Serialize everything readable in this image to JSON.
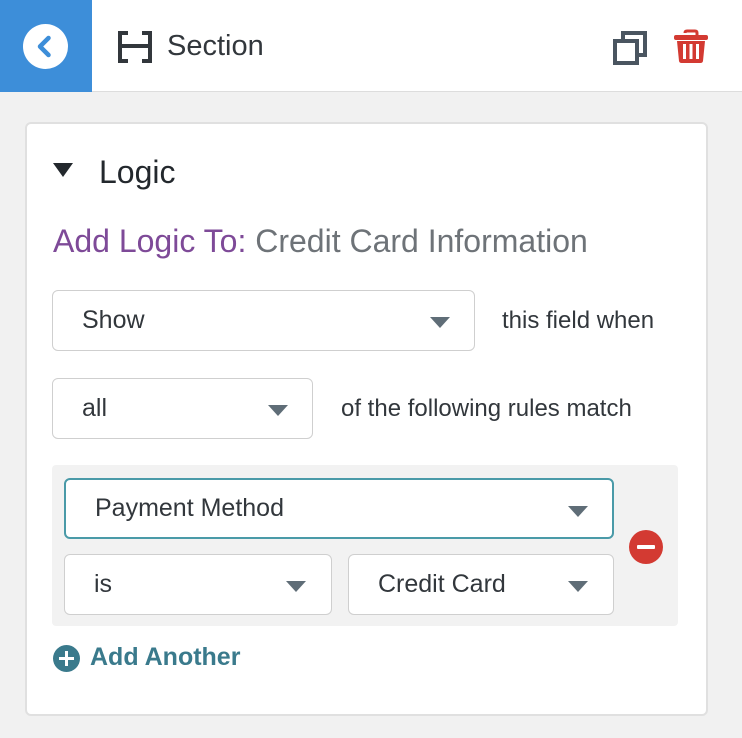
{
  "header": {
    "back_icon": "chevron-left-icon",
    "section_icon": "section-h-icon",
    "title": "Section",
    "duplicate_icon": "duplicate-icon",
    "delete_icon": "trash-icon",
    "accent_color": "#3d8ed9",
    "delete_color": "#d33a32"
  },
  "logic": {
    "toggle_icon": "triangle-down-icon",
    "title": "Logic",
    "add_logic_label": "Add Logic To:",
    "add_logic_target": "Credit Card Information",
    "label_color": "#7e4a98",
    "action_select": {
      "value": "Show"
    },
    "action_suffix": "this field when",
    "match_select": {
      "value": "all"
    },
    "match_suffix": "of the following rules match",
    "rules": [
      {
        "field": "Payment Method",
        "operator": "is",
        "value": "Credit Card",
        "remove_icon": "minus-circle-icon"
      }
    ],
    "add_another_icon": "plus-circle-icon",
    "add_another_label": "Add Another",
    "link_color": "#3a7a8c"
  }
}
